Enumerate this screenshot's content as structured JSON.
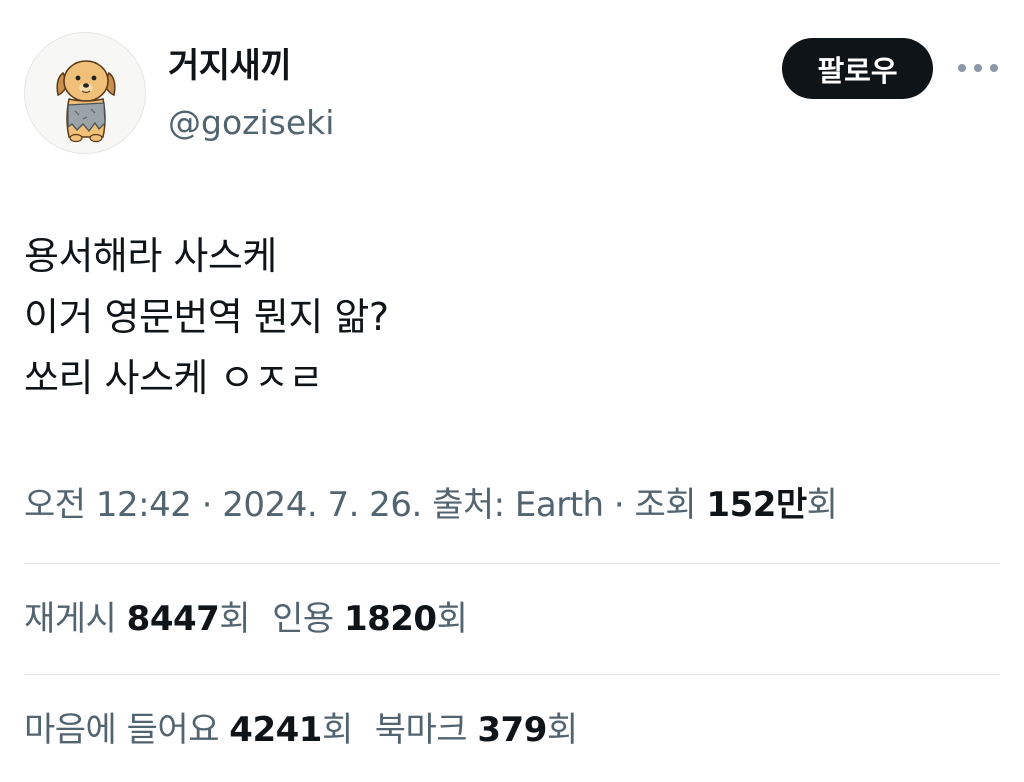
{
  "user": {
    "display_name": "거지새끼",
    "handle": "@goziseki",
    "avatar_icon": "dog-avatar-icon"
  },
  "actions": {
    "follow_label": "팔로우",
    "more_icon": "more-dots-icon"
  },
  "tweet": {
    "lines": [
      "용서해라 사스케",
      "이거 영문번역 뭔지 앎?",
      "쏘리 사스케 ㅇㅈㄹ"
    ]
  },
  "meta": {
    "time": "오전 12:42",
    "sep1": " · ",
    "date": "2024. 7. 26.",
    "source_label": " 출처: ",
    "source": "Earth",
    "sep2": " · ",
    "views_label": "조회 ",
    "views_value": "152만",
    "views_suffix": "회"
  },
  "stats": {
    "reposts_label": "재게시 ",
    "reposts_value": "8447",
    "reposts_suffix": "회",
    "quotes_label": "인용 ",
    "quotes_value": "1820",
    "quotes_suffix": "회",
    "likes_label": "마음에 들어요 ",
    "likes_value": "4241",
    "likes_suffix": "회",
    "bookmarks_label": "북마크 ",
    "bookmarks_value": "379",
    "bookmarks_suffix": "회"
  },
  "colors": {
    "text_primary": "#0f1419",
    "text_secondary": "#536471",
    "divider": "#e1e6ea",
    "button_bg": "#0f1419"
  }
}
